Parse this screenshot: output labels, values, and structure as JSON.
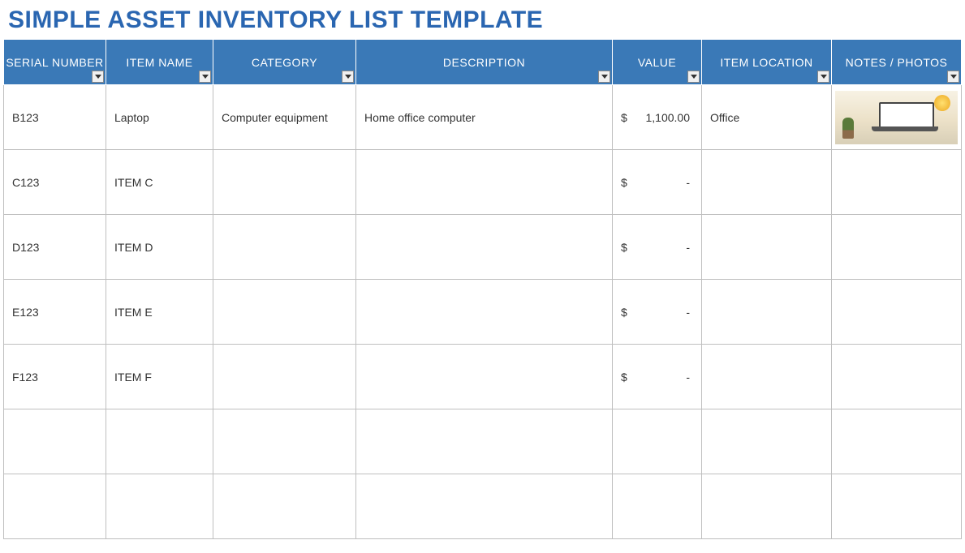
{
  "title": "SIMPLE ASSET INVENTORY LIST TEMPLATE",
  "columns": [
    {
      "key": "serial",
      "label": "SERIAL NUMBER"
    },
    {
      "key": "name",
      "label": "ITEM NAME"
    },
    {
      "key": "category",
      "label": "CATEGORY"
    },
    {
      "key": "desc",
      "label": "DESCRIPTION"
    },
    {
      "key": "value",
      "label": "VALUE"
    },
    {
      "key": "location",
      "label": "ITEM LOCATION"
    },
    {
      "key": "notes",
      "label": "NOTES / PHOTOS"
    }
  ],
  "currency_symbol": "$",
  "empty_value": "-",
  "rows": [
    {
      "serial": "B123",
      "name": "Laptop",
      "category": "Computer equipment",
      "desc": "Home office computer",
      "value": "1,100.00",
      "location": "Office",
      "has_photo": true
    },
    {
      "serial": "C123",
      "name": "ITEM C",
      "category": "",
      "desc": "",
      "value": "-",
      "location": "",
      "has_photo": false
    },
    {
      "serial": "D123",
      "name": "ITEM D",
      "category": "",
      "desc": "",
      "value": "-",
      "location": "",
      "has_photo": false
    },
    {
      "serial": "E123",
      "name": "ITEM E",
      "category": "",
      "desc": "",
      "value": "-",
      "location": "",
      "has_photo": false
    },
    {
      "serial": "F123",
      "name": "ITEM F",
      "category": "",
      "desc": "",
      "value": "-",
      "location": "",
      "has_photo": false
    },
    {
      "serial": "",
      "name": "",
      "category": "",
      "desc": "",
      "value": "",
      "location": "",
      "has_photo": false
    },
    {
      "serial": "",
      "name": "",
      "category": "",
      "desc": "",
      "value": "",
      "location": "",
      "has_photo": false
    }
  ]
}
